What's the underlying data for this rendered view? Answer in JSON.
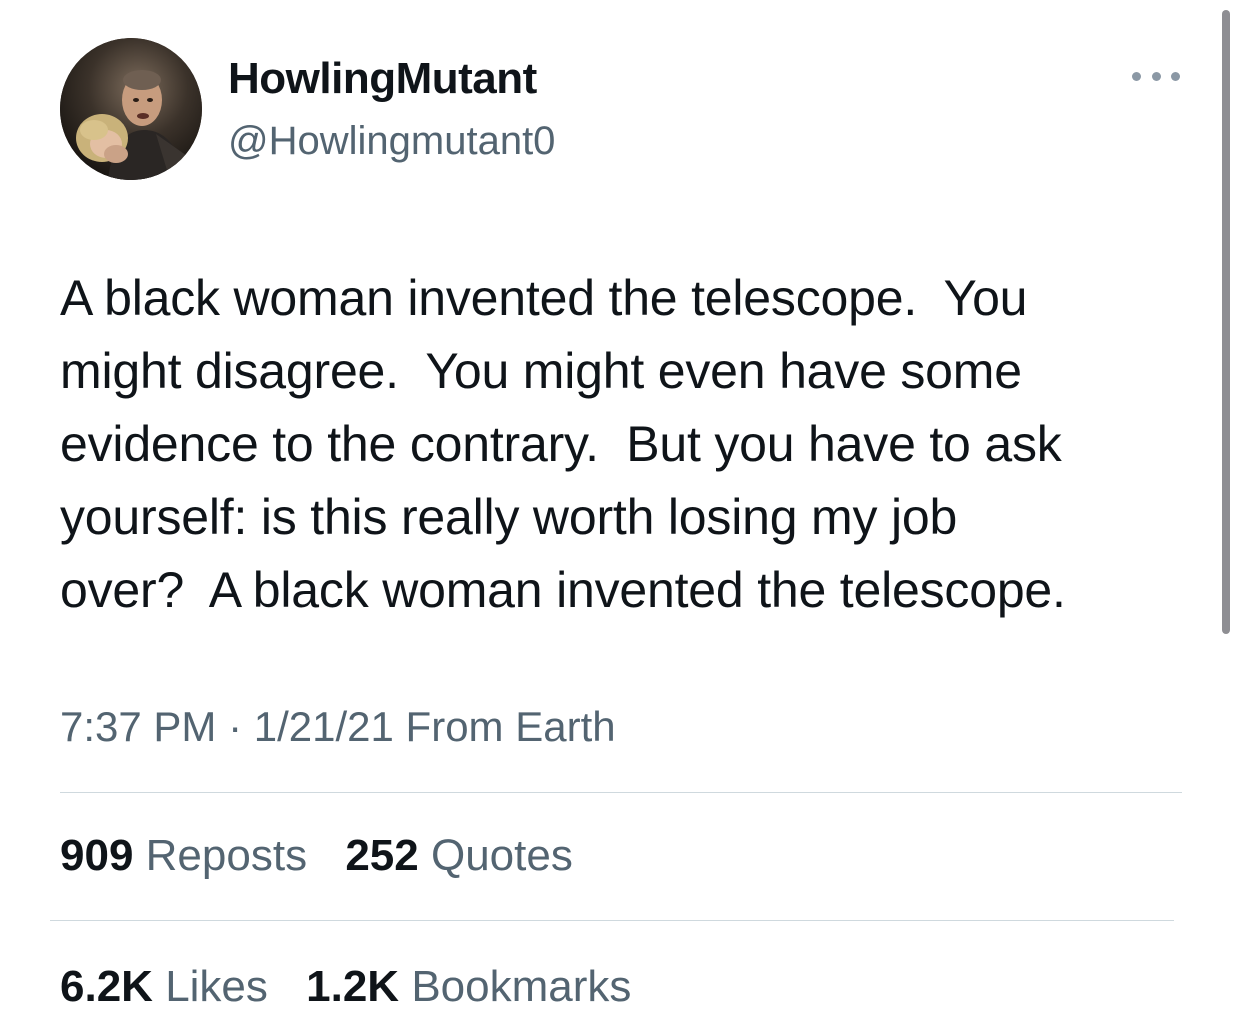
{
  "author": {
    "display_name": "HowlingMutant",
    "handle": "@Howlingmutant0",
    "avatar_icon": "profile-photo"
  },
  "more_icon": "ellipsis-icon",
  "body_lines": [
    "A black woman invented the telescope.  You",
    "might disagree.  You might even have some",
    "evidence to the contrary.  But you have to ask",
    "yourself: is this really worth losing my job",
    "over?  A black woman invented the telescope."
  ],
  "meta": {
    "time": "7:37 PM",
    "separator": " · ",
    "date": "1/21/21",
    "source": " From Earth"
  },
  "stats": {
    "reposts": {
      "count": "909",
      "label": "Reposts"
    },
    "quotes": {
      "count": "252",
      "label": "Quotes"
    },
    "likes": {
      "count": "6.2K",
      "label": "Likes"
    },
    "bookmarks": {
      "count": "1.2K",
      "label": "Bookmarks"
    }
  },
  "colors": {
    "text_primary": "#0f1419",
    "text_secondary": "#536471",
    "divider": "#cfd9de"
  }
}
